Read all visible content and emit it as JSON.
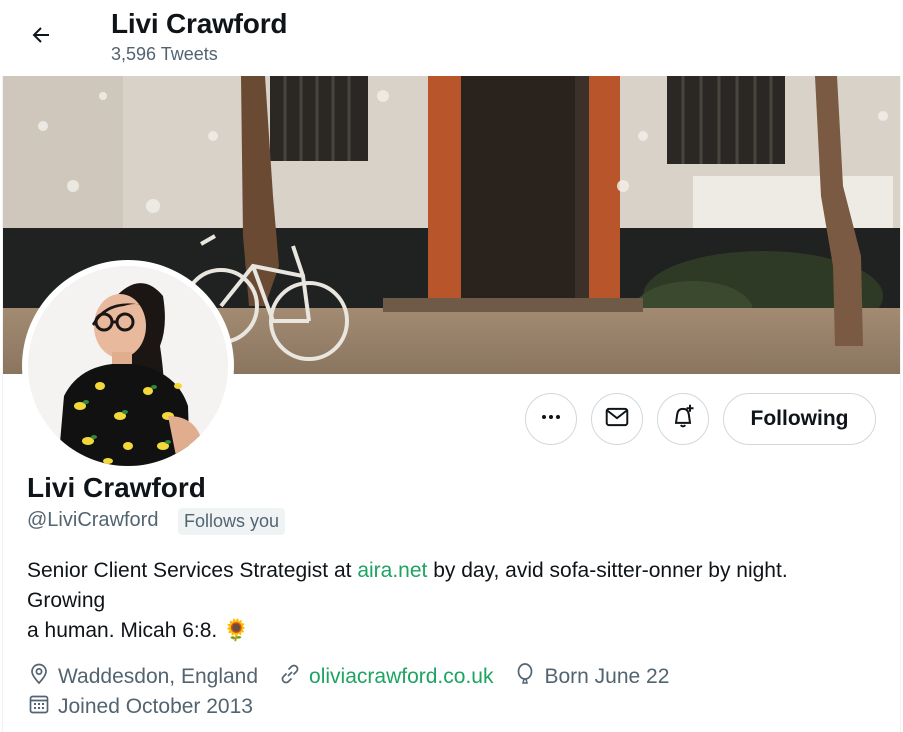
{
  "header": {
    "name": "Livi Crawford",
    "tweet_count": "3,596 Tweets"
  },
  "actions": {
    "following_label": "Following"
  },
  "profile": {
    "name": "Livi Crawford",
    "handle": "@LiviCrawford",
    "follows_you": "Follows you",
    "bio": {
      "before_link": "Senior Client Services Strategist at ",
      "link_text": "aira.net",
      "after_link": " by day, avid sofa-sitter-onner by night.",
      "line2": "Growing",
      "line3": "a human. Micah 6:8. 🌻"
    },
    "location": "Waddesdon, England",
    "website": "oliviacrawford.co.uk",
    "birthday": "Born June 22",
    "joined": "Joined October 2013"
  },
  "icons": {
    "back": "arrow-left-icon",
    "more": "more-dots-icon",
    "message": "envelope-icon",
    "notify": "bell-plus-icon",
    "location": "location-pin-icon",
    "link": "link-icon",
    "birthday": "balloon-icon",
    "calendar": "calendar-icon"
  },
  "colors": {
    "link": "#1da462",
    "secondary_text": "#536471",
    "primary_text": "#0f1419",
    "border": "#cfd9de"
  }
}
